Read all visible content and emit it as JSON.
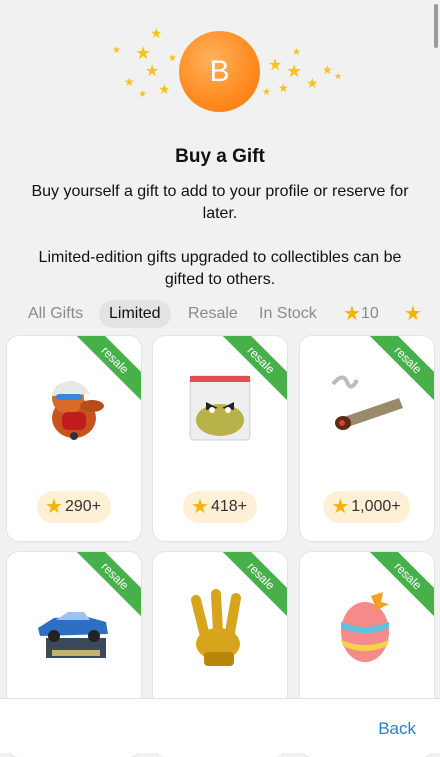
{
  "hero": {
    "avatar_letter": "B"
  },
  "title": "Buy a Gift",
  "description_1": "Buy yourself a gift to add to your profile or reserve for later.",
  "description_2": "Limited-edition gifts upgraded to collectibles can be gifted to others.",
  "tabs": [
    {
      "label": "All Gifts",
      "active": false
    },
    {
      "label": "Limited",
      "active": true
    },
    {
      "label": "Resale",
      "active": false
    },
    {
      "label": "In Stock",
      "active": false
    },
    {
      "label": "10",
      "star": true,
      "active": false
    }
  ],
  "gifts": [
    {
      "name": "dog-in-cap",
      "ribbon": "resale",
      "price": "290+"
    },
    {
      "name": "herb-bag",
      "ribbon": "resale",
      "price": "418+"
    },
    {
      "name": "smoking-roll",
      "ribbon": "resale",
      "price": "1,000+"
    },
    {
      "name": "blue-lowrider-car",
      "ribbon": "resale",
      "price": ""
    },
    {
      "name": "golden-hand-sign",
      "ribbon": "resale",
      "price": ""
    },
    {
      "name": "easter-egg",
      "ribbon": "resale",
      "price": ""
    }
  ],
  "footer": {
    "back_label": "Back"
  },
  "colors": {
    "accent": "#2481cc",
    "ribbon": "#47b04b",
    "star": "#f4b400",
    "avatar": "#ff8a1f"
  }
}
